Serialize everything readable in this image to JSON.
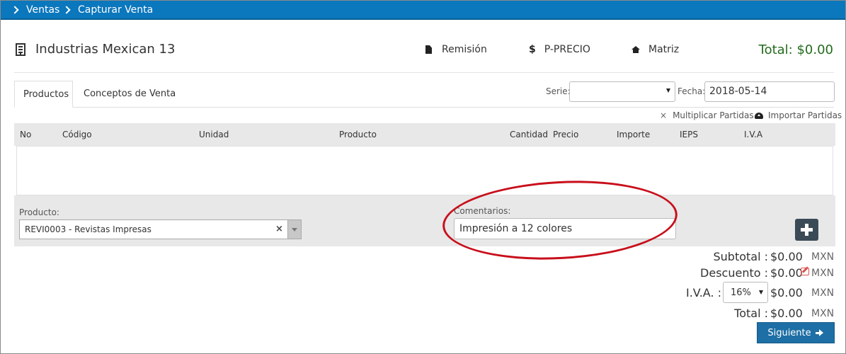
{
  "breadcrumb": [
    "Ventas",
    "Capturar Venta"
  ],
  "header": {
    "company": "Industrias Mexican 13",
    "links": {
      "remision": "Remisión",
      "pprecio": "P-PRECIO",
      "matriz": "Matriz"
    },
    "total": "Total: $0.00",
    "total_color": "#236b1c"
  },
  "tabs": [
    "Productos",
    "Conceptos de Venta"
  ],
  "filters": {
    "serie_label": "Serie:",
    "serie_value": "",
    "fecha_label": "Fecha:",
    "fecha_value": "2018-05-14"
  },
  "tools": {
    "multiplicar": "Multiplicar Partidas",
    "importar": "Importar Partidas"
  },
  "table": {
    "columns": [
      "No",
      "Código",
      "Unidad",
      "Producto",
      "Cantidad",
      "Precio",
      "Importe",
      "IEPS",
      "I.V.A"
    ],
    "rows": []
  },
  "entry": {
    "producto_label": "Producto:",
    "producto_value": "REVI0003 - Revistas Impresas",
    "comentarios_label": "Comentarios:",
    "comentarios_value": "Impresión a 12 colores"
  },
  "totals": {
    "subtotal_label": "Subtotal :",
    "subtotal": "$0.00",
    "descuento_label": "Descuento :",
    "descuento": "$0.00",
    "iva_label": "I.V.A. :",
    "iva_rate": "16%",
    "iva": "$0.00",
    "total_label": "Total :",
    "total": "$0.00",
    "currency": "MXN"
  },
  "next_button": "Siguiente",
  "colors": {
    "topbar": "#0b77bd",
    "highlight_oval": "#c80f1b",
    "next_button": "#1d6fa5"
  }
}
